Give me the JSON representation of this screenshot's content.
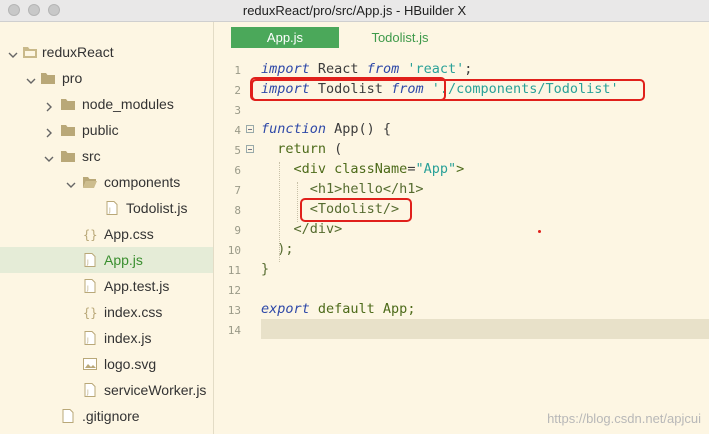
{
  "window": {
    "title": "reduxReact/pro/src/App.js - HBuilder X"
  },
  "sidebar": {
    "items": [
      {
        "label": "reduxReact",
        "icon": "project-folder-icon",
        "chevron": "chevron-down-icon"
      },
      {
        "label": "pro",
        "icon": "folder-icon",
        "chevron": "chevron-down-icon"
      },
      {
        "label": "node_modules",
        "icon": "folder-icon",
        "chevron": "chevron-right-icon"
      },
      {
        "label": "public",
        "icon": "folder-icon",
        "chevron": "chevron-right-icon"
      },
      {
        "label": "src",
        "icon": "folder-icon",
        "chevron": "chevron-down-icon"
      },
      {
        "label": "components",
        "icon": "folder-open-icon",
        "chevron": "chevron-down-icon"
      },
      {
        "label": "Todolist.js",
        "icon": "js-file-icon"
      },
      {
        "label": "App.css",
        "icon": "css-file-icon"
      },
      {
        "label": "App.js",
        "icon": "js-file-icon",
        "selected": true
      },
      {
        "label": "App.test.js",
        "icon": "js-file-icon"
      },
      {
        "label": "index.css",
        "icon": "css-file-icon"
      },
      {
        "label": "index.js",
        "icon": "js-file-icon"
      },
      {
        "label": "logo.svg",
        "icon": "image-file-icon"
      },
      {
        "label": "serviceWorker.js",
        "icon": "js-file-icon"
      },
      {
        "label": ".gitignore",
        "icon": "file-icon"
      }
    ]
  },
  "tabs": [
    {
      "label": "App.js",
      "active": true
    },
    {
      "label": "Todolist.js",
      "active": false
    }
  ],
  "editor": {
    "line_numbers": [
      "1",
      "2",
      "3",
      "4",
      "5",
      "6",
      "7",
      "8",
      "9",
      "10",
      "11",
      "12",
      "13",
      "14"
    ],
    "lines": {
      "l1": {
        "kw1": "import",
        "id": " React ",
        "kw2": "from",
        "str": " 'react'",
        "end": ";"
      },
      "l2": {
        "kw1": "import",
        "id": " Todolist ",
        "kw2": "from",
        "str": " './components/Todolist'"
      },
      "l4": {
        "kw": "function",
        "id": " App",
        "end": "() {"
      },
      "l5": {
        "kw": "  return",
        "end": " ("
      },
      "l6": {
        "pre": "    <",
        "tag": "div",
        "attr": " className",
        "eq": "=",
        "str": "\"App\"",
        "end": ">"
      },
      "l7": {
        "text": "      <h1>hello</h1>"
      },
      "l8": {
        "text": "      <Todolist/>"
      },
      "l9": {
        "text": "    </div>"
      },
      "l10": {
        "text": "  );"
      },
      "l11": {
        "text": "}"
      },
      "l13": {
        "kw": "export",
        "rest": " default App;"
      }
    }
  },
  "watermark": "https://blog.csdn.net/apjcui",
  "colors": {
    "accent": "#4ba85a",
    "highlight_box": "#e0201b",
    "editor_bg": "#fdf6e3"
  }
}
